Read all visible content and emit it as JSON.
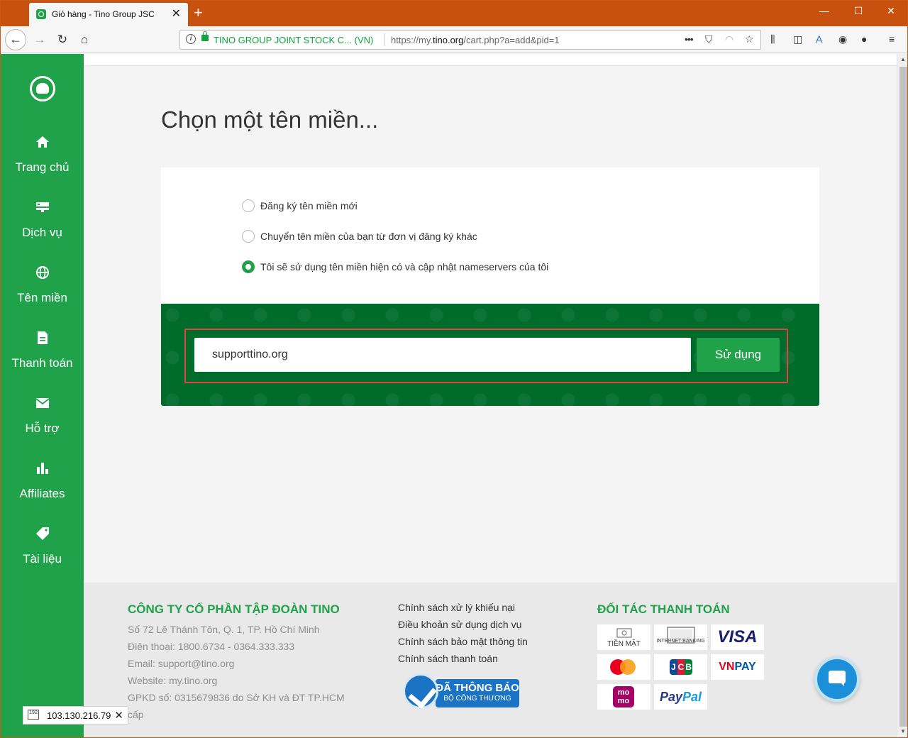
{
  "browser": {
    "tab_title": "Giỏ hàng - Tino Group JSC",
    "tab_close": "✕",
    "new_tab": "+",
    "win_min": "—",
    "win_max": "☐",
    "win_close": "✕",
    "url_org": "TINO GROUP JOINT STOCK C...  (VN)",
    "url_prefix": "https://my.",
    "url_host": "tino.org",
    "url_path": "/cart.php?a=add&pid=1",
    "more_icon": "•••",
    "icons": [
      "back-arrow-icon",
      "forward-arrow-icon",
      "reload-icon",
      "home-icon",
      "info-icon",
      "lock-icon",
      "more-icon",
      "pocket-icon",
      "bookmark-star-icon",
      "library-icon",
      "sidebar-icon",
      "translate-icon",
      "extension-icon",
      "account-icon",
      "menu-icon"
    ]
  },
  "sidebar": {
    "items": [
      {
        "label": "Trang chủ",
        "icon": "home-icon"
      },
      {
        "label": "Dịch vụ",
        "icon": "server-icon"
      },
      {
        "label": "Tên miền",
        "icon": "globe-icon"
      },
      {
        "label": "Thanh toán",
        "icon": "invoice-icon"
      },
      {
        "label": "Hỗ trợ",
        "icon": "envelope-icon"
      },
      {
        "label": "Affiliates",
        "icon": "bar-chart-icon"
      },
      {
        "label": "Tài liệu",
        "icon": "tag-icon"
      }
    ]
  },
  "main": {
    "title": "Chọn một tên miền...",
    "options": [
      {
        "label": "Đăng ký tên miền mới",
        "selected": false
      },
      {
        "label": "Chuyển tên miền của bạn từ đơn vị đăng ký khác",
        "selected": false
      },
      {
        "label": "Tôi sẽ sử dụng tên miền hiện có và cập nhật nameservers của tôi",
        "selected": true
      }
    ],
    "domain_value": "supporttino.org",
    "use_button": "Sử dụng"
  },
  "footer": {
    "company_heading": "CÔNG TY CỔ PHẦN TẬP ĐOÀN TINO",
    "address": "Số 72 Lê Thánh Tôn, Q. 1, TP. Hồ Chí Minh",
    "phone": "Điện thoại: 1800.6734 - 0364.333.333",
    "email": "Email: support@tino.org",
    "website": "Website: my.tino.org",
    "gpkd": "GPKD số: 0315679836 do Sở KH và ĐT TP.HCM",
    "gpkd_cont": "cấp",
    "links": [
      "Chính sách xử lý khiếu nại",
      "Điều khoản sử dụng dịch vụ",
      "Chính sách bảo mật thông tin",
      "Chính sách thanh toán"
    ],
    "badge_line1": "ĐÃ THÔNG BÁO",
    "badge_line2": "BỘ CÔNG THƯƠNG",
    "partners_heading": "ĐỐI TÁC THANH TOÁN",
    "pay_cash": "TIỀN MẶT",
    "pay_ib": "INTERNET BANKING",
    "pay_visa": "VISA",
    "pay_vn": "VN",
    "pay_pay": "PAY",
    "pay_jcb": [
      "J",
      "C",
      "B"
    ],
    "pay_momo": "mo mo",
    "pay_paypal_a": "Pay",
    "pay_paypal_b": "Pal"
  },
  "ip_badge": {
    "value": "103.130.216.79",
    "close": "✕",
    "icon_text": "192"
  },
  "colors": {
    "brand_green": "#20a24b",
    "dark_green": "#006c2c",
    "highlight_red": "#e2443f",
    "title_bar": "#c8510f"
  }
}
